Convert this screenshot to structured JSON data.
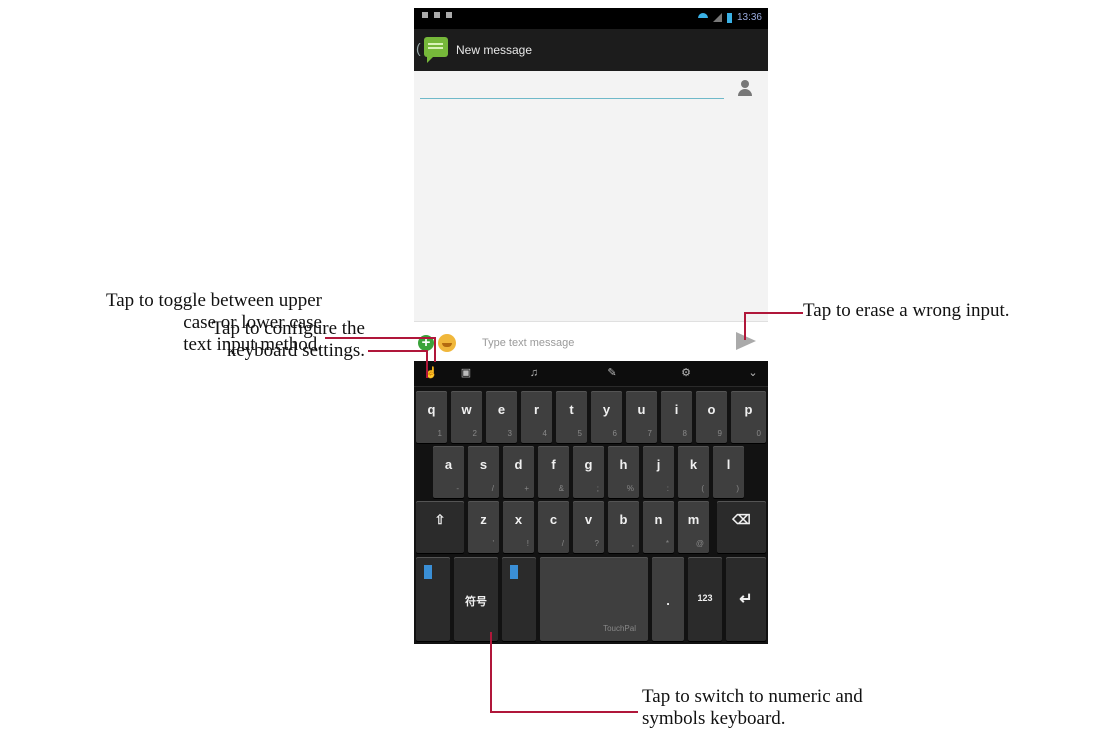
{
  "phone": {
    "status_time": "13:36",
    "title": "New message",
    "back_glyph": "(",
    "compose": {
      "placeholder": "Type text message",
      "plus_glyph": "+"
    },
    "toolbar": {
      "icons": [
        "hand-pointer-icon",
        "layout-icon",
        "microphone-icon",
        "pen-icon",
        "tools-icon",
        "chevron-down-icon"
      ],
      "glyphs": [
        "☝",
        "▣",
        "♫",
        "✎",
        "⚙",
        "⌄"
      ]
    },
    "keyboard": {
      "row1": [
        {
          "ch": "q",
          "sub": "1"
        },
        {
          "ch": "w",
          "sub": "2"
        },
        {
          "ch": "e",
          "sub": "3"
        },
        {
          "ch": "r",
          "sub": "4"
        },
        {
          "ch": "t",
          "sub": "5"
        },
        {
          "ch": "y",
          "sub": "6"
        },
        {
          "ch": "u",
          "sub": "7"
        },
        {
          "ch": "i",
          "sub": "8"
        },
        {
          "ch": "o",
          "sub": "9"
        },
        {
          "ch": "p",
          "sub": "0"
        }
      ],
      "row2": [
        {
          "ch": "a",
          "sub": "-"
        },
        {
          "ch": "s",
          "sub": "/"
        },
        {
          "ch": "d",
          "sub": "+"
        },
        {
          "ch": "f",
          "sub": "&"
        },
        {
          "ch": "g",
          "sub": ";"
        },
        {
          "ch": "h",
          "sub": "%"
        },
        {
          "ch": "j",
          "sub": ":"
        },
        {
          "ch": "k",
          "sub": "("
        },
        {
          "ch": "l",
          "sub": ")"
        }
      ],
      "row3": [
        {
          "ch": "z",
          "sub": "'"
        },
        {
          "ch": "x",
          "sub": "!"
        },
        {
          "ch": "c",
          "sub": "/"
        },
        {
          "ch": "v",
          "sub": "?"
        },
        {
          "ch": "b",
          "sub": ","
        },
        {
          "ch": "n",
          "sub": "*"
        },
        {
          "ch": "m",
          "sub": "@"
        }
      ],
      "shift_glyph": "⇧",
      "delete_glyph": "⌫",
      "lang_label": "符号",
      "space_brand": "TouchPal",
      "period": ".",
      "numeric_label": "123",
      "enter_glyph": "↵"
    }
  },
  "callouts": {
    "settings": "Tap to configure the\nkeyboard settings.",
    "shift": "Tap to toggle between upper\ncase or lower case\ntext input method.",
    "erase": "Tap to erase a wrong input.",
    "numeric": "Tap to switch to numeric and\nsymbols keyboard."
  }
}
